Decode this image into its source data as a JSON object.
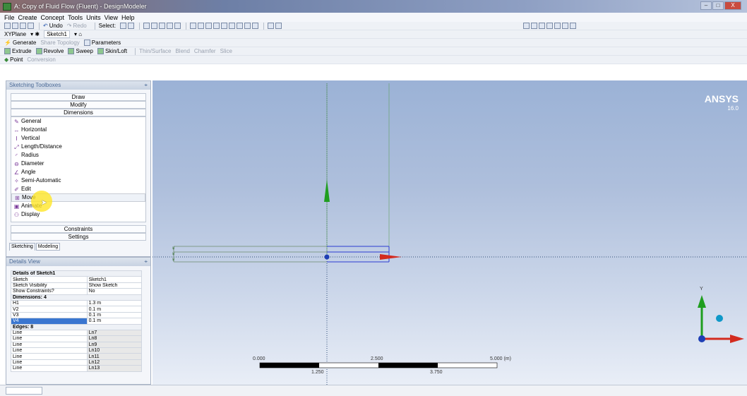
{
  "window": {
    "title": "A: Copy of Fluid Flow (Fluent) - DesignModeler",
    "controls": [
      "–",
      "□",
      "X"
    ]
  },
  "menu": [
    "File",
    "Create",
    "Concept",
    "Tools",
    "Units",
    "View",
    "Help"
  ],
  "toolbar1": {
    "undo": "Undo",
    "redo": "Redo",
    "select": "Select:"
  },
  "toolbar2": {
    "plane": "XYPlane",
    "sketch": "Sketch1"
  },
  "toolbar3": {
    "generate": "Generate",
    "share_topology": "Share Topology",
    "parameters": "Parameters"
  },
  "toolbar4": {
    "extrude": "Extrude",
    "revolve": "Revolve",
    "sweep": "Sweep",
    "skin_loft": "Skin/Loft",
    "thin_surface": "Thin/Surface",
    "blend": "Blend",
    "chamfer": "Chamfer",
    "slice": "Slice"
  },
  "toolbar5": {
    "point": "Point",
    "conversion": "Conversion"
  },
  "toolboxes": {
    "title": "Sketching Toolboxes",
    "groups": {
      "draw": "Draw",
      "modify": "Modify",
      "dimensions": "Dimensions",
      "constraints": "Constraints",
      "settings": "Settings"
    },
    "items": [
      {
        "label": "General",
        "icon": "pencil-icon"
      },
      {
        "label": "Horizontal",
        "icon": "horizontal-dimension-icon"
      },
      {
        "label": "Vertical",
        "icon": "vertical-dimension-icon"
      },
      {
        "label": "Length/Distance",
        "icon": "length-icon"
      },
      {
        "label": "Radius",
        "icon": "radius-icon"
      },
      {
        "label": "Diameter",
        "icon": "diameter-icon"
      },
      {
        "label": "Angle",
        "icon": "angle-icon"
      },
      {
        "label": "Semi-Automatic",
        "icon": "semi-automatic-icon"
      },
      {
        "label": "Edit",
        "icon": "edit-icon"
      },
      {
        "label": "Move",
        "icon": "move-icon"
      },
      {
        "label": "Animate",
        "icon": "animate-icon"
      },
      {
        "label": "Display",
        "icon": "display-icon"
      }
    ],
    "tabs": [
      "Sketching",
      "Modeling"
    ]
  },
  "details": {
    "title": "Details View",
    "section_title": "Details of Sketch1",
    "props": [
      [
        "Sketch",
        "Sketch1"
      ],
      [
        "Sketch Visibility",
        "Show Sketch"
      ],
      [
        "Show Constraints?",
        "No"
      ]
    ],
    "dimensions_header": "Dimensions: 4",
    "dimensions": [
      [
        "H1",
        "1.3 m"
      ],
      [
        "V2",
        "0.1 m"
      ],
      [
        "V3",
        "0.1 m"
      ],
      [
        "V4",
        "0.1 m"
      ]
    ],
    "edges_header": "Edges: 8",
    "edges": [
      [
        "Line",
        "Ln7"
      ],
      [
        "Line",
        "Ln8"
      ],
      [
        "Line",
        "Ln9"
      ],
      [
        "Line",
        "Ln10"
      ],
      [
        "Line",
        "Ln11"
      ],
      [
        "Line",
        "Ln12"
      ],
      [
        "Line",
        "Ln13"
      ]
    ]
  },
  "viewport": {
    "logo": "ANSYS",
    "version": "16.0",
    "scale_top": [
      "0.000",
      "2.500",
      "5.000 (m)"
    ],
    "scale_bottom": [
      "1.250",
      "3.750"
    ],
    "triad_y": "Y"
  },
  "colors": {
    "accent": "#3a76d0",
    "triad_y": "#1f9e1f",
    "triad_x": "#d32b1f",
    "triad_z": "#0f98c8",
    "sketch_line": "#2b3bd1"
  }
}
